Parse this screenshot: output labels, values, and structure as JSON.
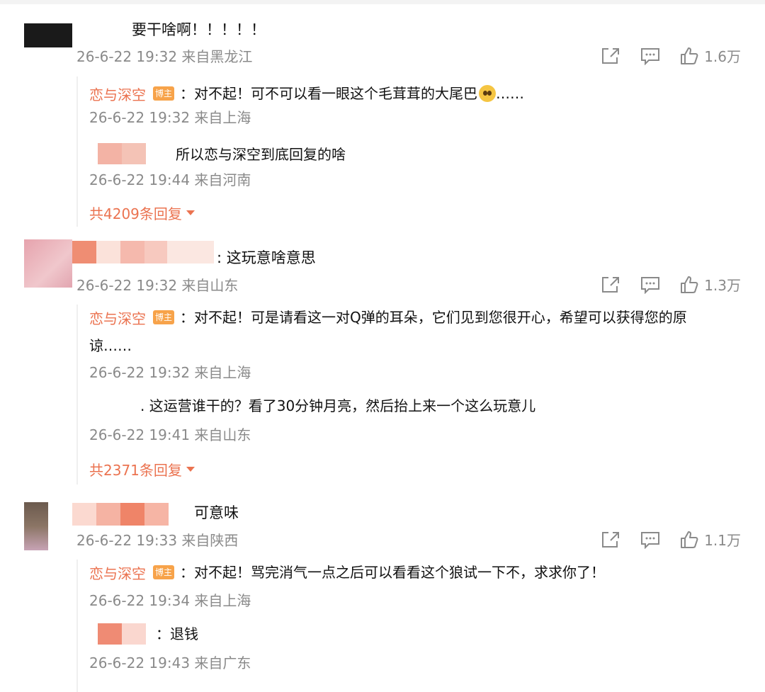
{
  "colors": {
    "accent": "#eb7350",
    "meta": "#8a8a8a",
    "badge": "#f7a34a"
  },
  "icons": {
    "share": "share-icon",
    "comment": "comment-icon",
    "like": "thumbs-up-icon",
    "expand": "caret-down-icon",
    "emoji": "pleading-face-emoji"
  },
  "comments": [
    {
      "text": "要干啥啊！！！！！",
      "time": "26-6-22 19:32 来自黑龙江",
      "likes": "1.6万",
      "replies": [
        {
          "name": "恋与深空",
          "badge": "博主",
          "text": "：对不起！可不可以看一眼这个毛茸茸的大尾巴",
          "suffix": "……",
          "time": "26-6-22 19:32 来自上海"
        },
        {
          "text": "所以恋与深空到底回复的啥",
          "time": "26-6-22 19:44 来自河南"
        }
      ],
      "more": "共4209条回复"
    },
    {
      "text": ": 这玩意啥意思",
      "time": "26-6-22 19:32 来自山东",
      "likes": "1.3万",
      "replies": [
        {
          "name": "恋与深空",
          "badge": "博主",
          "text": "：对不起！可是请看这一对Q弹的耳朵，它们见到您很开心，希望可以获得您的原",
          "text2": "谅……",
          "time": "26-6-22 19:32 来自上海"
        },
        {
          "text": ". 这运营谁干的？看了30分钟月亮，然后抬上来一个这么玩意儿",
          "time": "26-6-22 19:41 来自山东"
        }
      ],
      "more": "共2371条回复"
    },
    {
      "text": "可意味",
      "time": "26-6-22 19:33 来自陕西",
      "likes": "1.1万",
      "replies": [
        {
          "name": "恋与深空",
          "badge": "博主",
          "text": "：对不起！骂完消气一点之后可以看看这个狼试一下不，求求你了！",
          "time": "26-6-22 19:34 来自上海"
        },
        {
          "text": "：退钱",
          "time": "26-6-22 19:43 来自广东"
        }
      ]
    }
  ]
}
